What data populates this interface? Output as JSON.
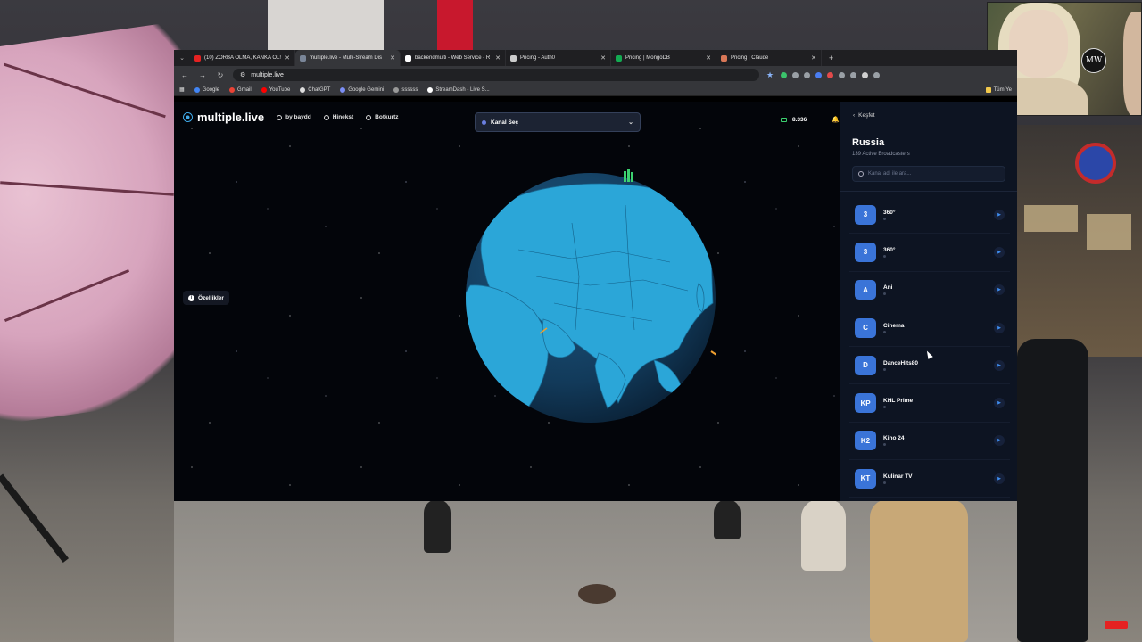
{
  "browser": {
    "tabs": [
      {
        "title": "(10) ZORBA OLMA, KANKA OL!",
        "color": "#e52222"
      },
      {
        "title": "multiple.live - Multi-Stream Dis",
        "color": "#7a8699",
        "active": true
      },
      {
        "title": "backendmulti - Web Service - R",
        "color": "#ffffff"
      },
      {
        "title": "Pricing - Auth0",
        "color": "#cccccc"
      },
      {
        "title": "Pricing | MongoDB",
        "color": "#13aa52"
      },
      {
        "title": "Pricing | Claude",
        "color": "#d97757"
      }
    ],
    "new_tab": "+",
    "url": "multiple.live",
    "bookmarks": [
      {
        "label": "Google",
        "color": "#4285f4"
      },
      {
        "label": "Gmail",
        "color": "#ea4335"
      },
      {
        "label": "YouTube",
        "color": "#ff0000"
      },
      {
        "label": "ChatGPT",
        "color": "#dddddd"
      },
      {
        "label": "Google Gemini",
        "color": "#7b8ef5"
      },
      {
        "label": "ssssss",
        "color": "#999999"
      },
      {
        "label": "StreamDash - Live S...",
        "color": "#ffffff"
      }
    ],
    "bookmarks_more": "Tüm Ye"
  },
  "site": {
    "logo": "multiple.live",
    "nav": [
      "by baydd",
      "Hinekst",
      "Botkurtz"
    ],
    "channel_select": "Kanal Seç",
    "viewer_count": "8.336",
    "features_button": "Özellikler"
  },
  "panel": {
    "back": "Keşfet",
    "country": "Russia",
    "broadcasters": "139 Active Broadcasters",
    "search_placeholder": "Kanal adı ile ara...",
    "channels": [
      {
        "badge": "3",
        "name": "360°"
      },
      {
        "badge": "3",
        "name": "360°"
      },
      {
        "badge": "A",
        "name": "Ani"
      },
      {
        "badge": "C",
        "name": "Cinema"
      },
      {
        "badge": "D",
        "name": "DanceHits80"
      },
      {
        "badge": "KP",
        "name": "KHL Prime"
      },
      {
        "badge": "K2",
        "name": "Kino 24"
      },
      {
        "badge": "KT",
        "name": "Kulinar TV"
      }
    ]
  },
  "overlay": {
    "cam_logo": "MW"
  },
  "colors": {
    "accent": "#3a74d8",
    "globe_ocean": "#123a5a",
    "globe_land": "#2ba6d8"
  }
}
